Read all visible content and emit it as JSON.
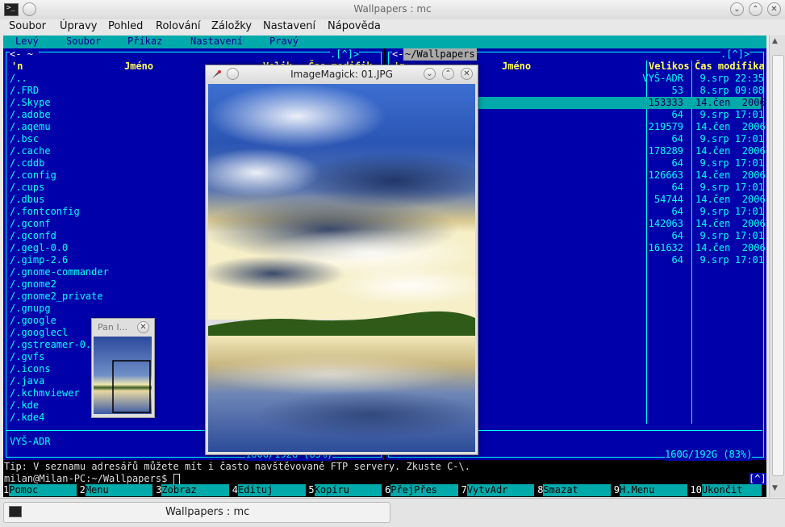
{
  "window": {
    "title": "Wallpapers : mc"
  },
  "menubar": [
    "Soubor",
    "Úpravy",
    "Pohled",
    "Rolování",
    "Záložky",
    "Nastavení",
    "Nápověda"
  ],
  "mc_menu": [
    "Levý",
    "Soubor",
    "Příkaz",
    "Nastavení",
    "Pravý"
  ],
  "left_panel": {
    "path": "~",
    "corner": ".[^]>",
    "col_n": "'n",
    "col_name": "Jméno",
    "col_size": "Velik",
    "col_time": "Čas modifik",
    "files": [
      "/..",
      "/.FRD",
      "/.Skype",
      "/.adobe",
      "/.aqemu",
      "/.bsc",
      "/.cache",
      "/.cddb",
      "/.config",
      "/.cups",
      "/.dbus",
      "/.fontconfig",
      "/.gconf",
      "/.gconfd",
      "/.gegl-0.0",
      "/.gimp-2.6",
      "/.gnome-commander",
      "/.gnome2",
      "/.gnome2_private",
      "/.gnupg",
      "/.google",
      "/.googlecl",
      "/.gstreamer-0.10",
      "/.gvfs",
      "/.icons",
      "/.java",
      "/.kchmviewer",
      "/.kde",
      "/.kde4"
    ],
    "status": "VYŠ-ADR",
    "disk": "160G/192G (83%)"
  },
  "right_panel": {
    "path": "~/Wallpapers",
    "corner": ".[^]>",
    "col_n": "'n",
    "col_name": "Jméno",
    "col_size": "Velikos",
    "col_time": "Čas modifika",
    "rows": [
      {
        "size": "VYŠ-ADR",
        "time": "9.srp 22:35"
      },
      {
        "size": "53",
        "time": "8.srp 09:08"
      },
      {
        "size": "153333",
        "time": "14.čen  2006"
      },
      {
        "size": "64",
        "time": "9.srp 17:01"
      },
      {
        "size": "219579",
        "time": "14.čen  2006"
      },
      {
        "size": "64",
        "time": "9.srp 17:01"
      },
      {
        "size": "178289",
        "time": "14.čen  2006"
      },
      {
        "size": "64",
        "time": "9.srp 17:01"
      },
      {
        "size": "126663",
        "time": "14.čen  2006"
      },
      {
        "size": "64",
        "time": "9.srp 17:01"
      },
      {
        "size": "54744",
        "time": "14.čen  2006"
      },
      {
        "size": "64",
        "time": "9.srp 17:01"
      },
      {
        "size": "142063",
        "time": "14.čen  2006"
      },
      {
        "size": "64",
        "time": "9.srp 17:01"
      },
      {
        "size": "161632",
        "time": "14.čen  2006"
      },
      {
        "size": "64",
        "time": "9.srp 17:01"
      }
    ],
    "disk": "160G/192G (83%)"
  },
  "tip": "Tip: V seznamu adresářů můžete mít i často navštěvované FTP servery. Zkuste C-\\.",
  "prompt": "milan@Milan-PC:~/Wallpapers$",
  "prompt_badge": "[^]",
  "fkeys": [
    {
      "n": "1",
      "label": "Pomoc"
    },
    {
      "n": "2",
      "label": "Menu"
    },
    {
      "n": "3",
      "label": "Zobraz"
    },
    {
      "n": "4",
      "label": "Edituj"
    },
    {
      "n": "5",
      "label": "Kopíru"
    },
    {
      "n": "6",
      "label": "PřejPřes"
    },
    {
      "n": "7",
      "label": "VytvAdr"
    },
    {
      "n": "8",
      "label": "Smazat"
    },
    {
      "n": "9",
      "label": "H.Menu"
    },
    {
      "n": "10",
      "label": "Ukončit"
    }
  ],
  "imagemagick": {
    "title": "ImageMagick: 01.JPG"
  },
  "pan": {
    "title": "Pan I..."
  },
  "taskbar": {
    "task": "Wallpapers : mc"
  }
}
